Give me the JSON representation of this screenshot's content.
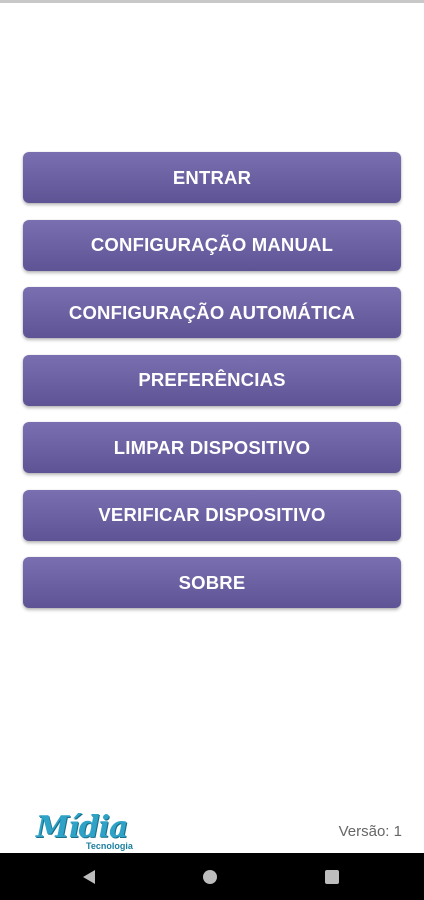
{
  "menu": {
    "items": [
      {
        "label": "ENTRAR"
      },
      {
        "label": "CONFIGURAÇÃO MANUAL"
      },
      {
        "label": "CONFIGURAÇÃO AUTOMÁTICA"
      },
      {
        "label": "PREFERÊNCIAS"
      },
      {
        "label": "LIMPAR DISPOSITIVO"
      },
      {
        "label": "VERIFICAR DISPOSITIVO"
      },
      {
        "label": "SOBRE"
      }
    ]
  },
  "footer": {
    "logo_name": "Mídia",
    "logo_sub": "Tecnologia",
    "version": "Versão: 1"
  },
  "navbar": {
    "icons": [
      "back-icon",
      "home-icon",
      "recent-apps-icon"
    ]
  },
  "colors": {
    "button_top": "#7a6fb0",
    "button_bottom": "#5e5495",
    "logo_blue": "#2ea3c7"
  }
}
